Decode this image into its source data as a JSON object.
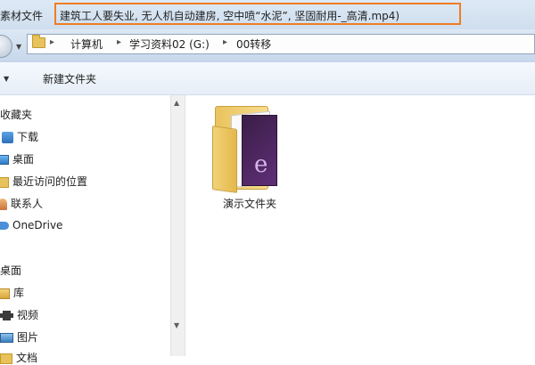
{
  "window": {
    "title_prefix": "素材文件",
    "title_highlight": "建筑工人要失业, 无人机自动建房, 空中喷“水泥”, 坚固耐用-_高清.mp4)"
  },
  "address": {
    "breadcrumbs": [
      "计算机",
      "学习资料02 (G:)",
      "00转移"
    ],
    "separator": "▸"
  },
  "toolbar": {
    "new_folder": "新建文件夹"
  },
  "nav": {
    "favorites_header": "收藏夹",
    "favorites": [
      "下载",
      "桌面",
      "最近访问的位置",
      "联系人",
      "OneDrive"
    ],
    "desktop_header": "桌面",
    "desktop_items": [
      "库",
      "视频",
      "图片",
      "文档"
    ]
  },
  "content": {
    "folder_name": "演示文件夹"
  },
  "colors": {
    "highlight_border": "#ef7d24"
  }
}
